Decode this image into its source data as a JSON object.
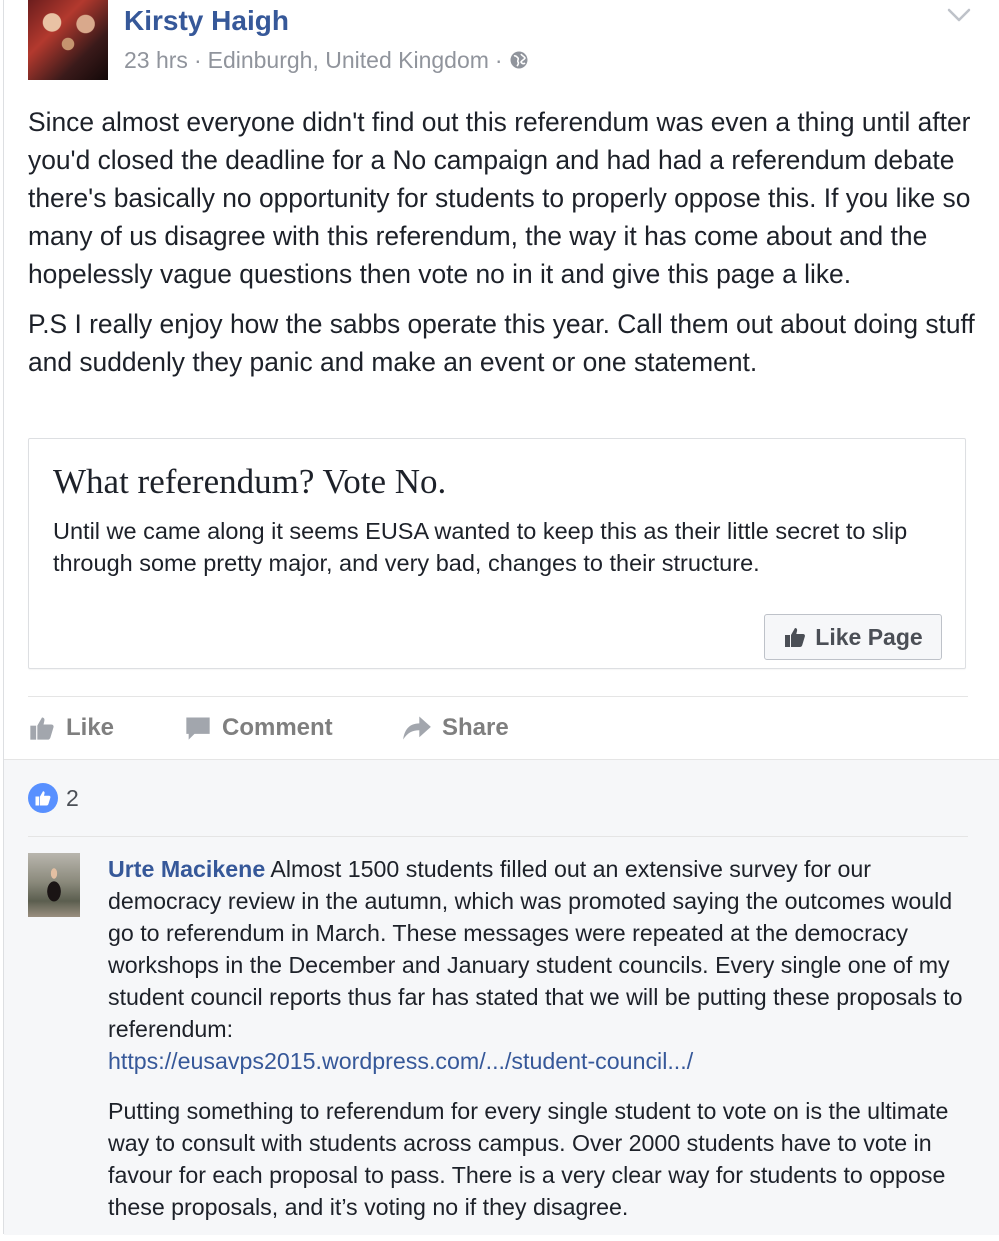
{
  "post": {
    "author": "Kirsty Haigh",
    "time": "23 hrs",
    "location": "Edinburgh, United Kingdom",
    "separator": "·",
    "paragraphs": [
      "Since almost everyone didn't find out this referendum was even a thing until after you'd closed the deadline for a No campaign and had had a referendum debate there's basically no opportunity for students to properly oppose this. If you like so many of us disagree with this referendum, the way it has come about and the hopelessly vague questions then vote no in it and give this page a like.",
      "P.S I really enjoy how the sabbs operate this year. Call them out about doing stuff and suddenly they panic and make an event or one statement."
    ]
  },
  "link_card": {
    "title": "What referendum? Vote No.",
    "description": "Until we came along it seems EUSA wanted to keep this as their little secret to slip through some pretty major, and very bad, changes to their structure.",
    "button_label": "Like Page"
  },
  "actions": {
    "like": "Like",
    "comment": "Comment",
    "share": "Share"
  },
  "reactions": {
    "count": "2"
  },
  "comment": {
    "author": "Urte Macikene",
    "paragraph1": "Almost 1500 students filled out an extensive survey for our democracy review in the autumn, which was promoted saying the outcomes would go to referendum in March. These messages were repeated at the democracy workshops in the December and January student councils. Every single one of my student council reports thus far has stated that we will be putting these proposals to referendum:",
    "link": "https://eusavps2015.wordpress.com/.../student-council.../",
    "paragraph2": "Putting something to referendum for every single student to vote on is the ultimate way to consult with students across campus. Over 2000 students have to vote in favour for each proposal to pass. There is a very clear way for students to oppose these proposals, and it’s voting no if they disagree."
  },
  "colors": {
    "link_blue": "#365899",
    "meta_gray": "#90949c",
    "like_blue": "#5890ff",
    "comment_bg": "#f6f7f9"
  }
}
